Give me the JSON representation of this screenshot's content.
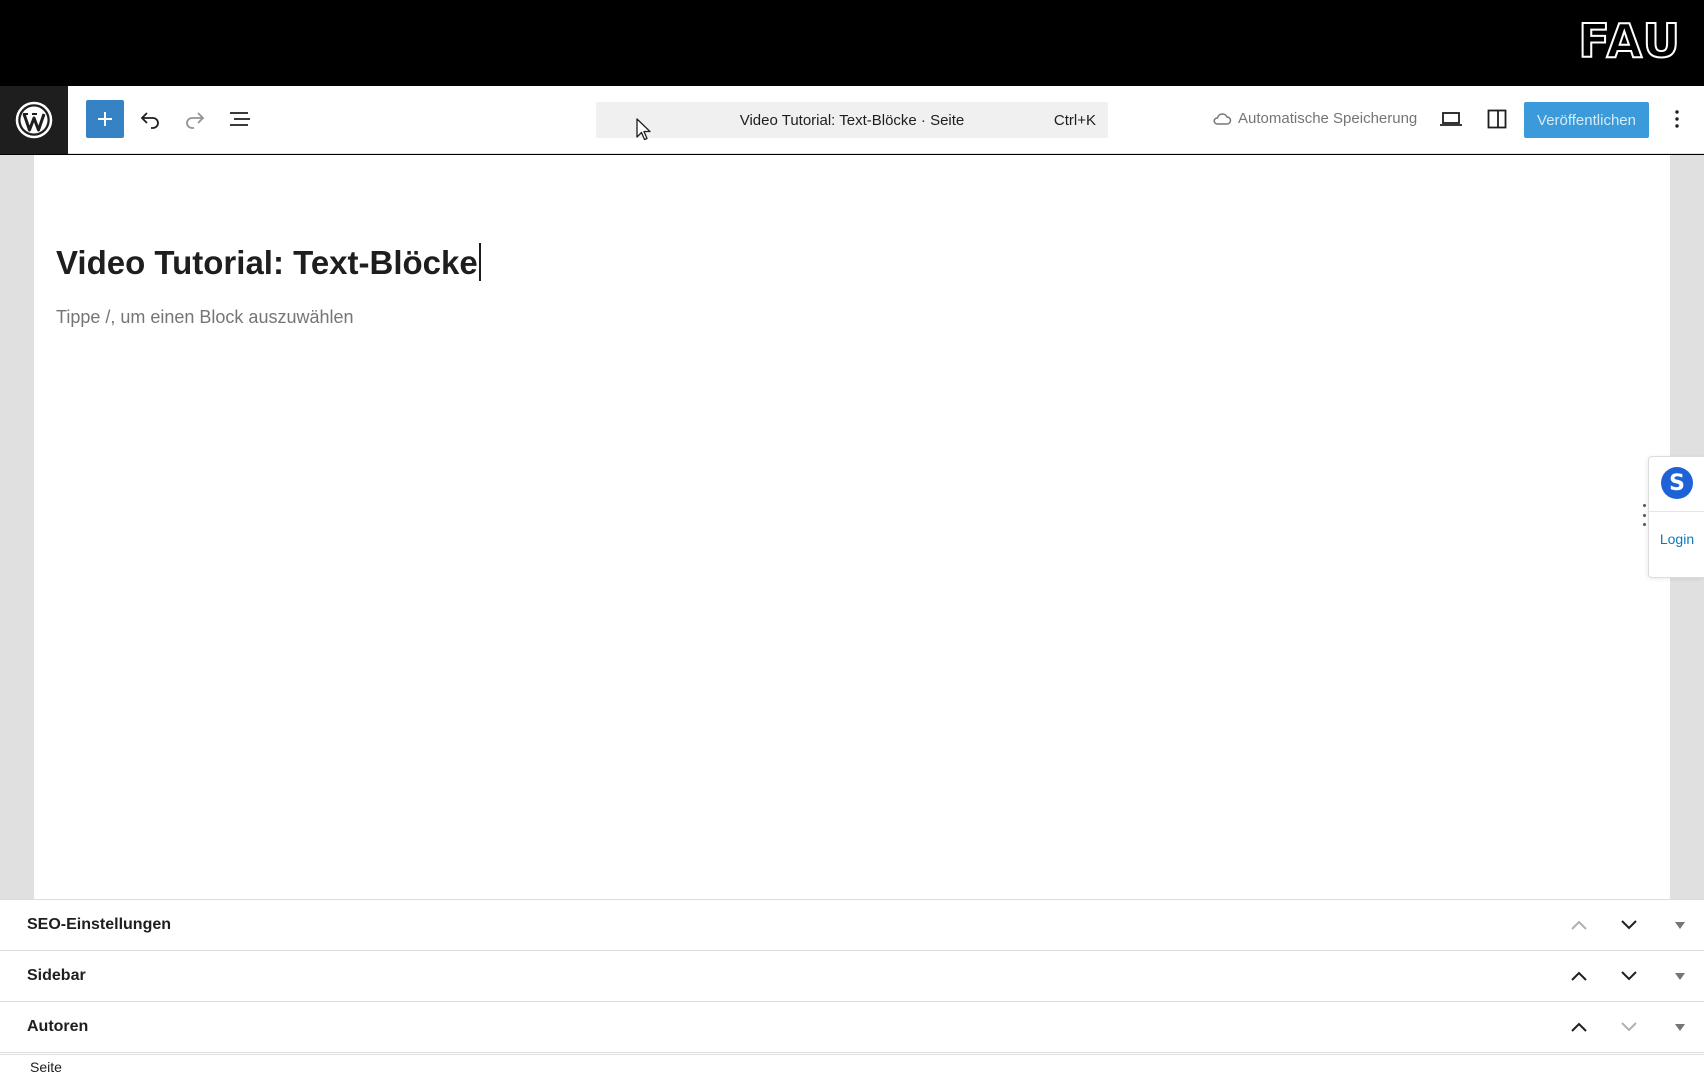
{
  "brand": {
    "logo_text": "FAU"
  },
  "toolbar": {
    "add_block_icon": "plus-icon",
    "undo_icon": "undo-icon",
    "redo_icon": "redo-icon",
    "list_view_icon": "list-view-icon",
    "command": {
      "title": "Video Tutorial: Text-Blöcke · Seite",
      "shortcut": "Ctrl+K"
    },
    "autosave": "Automatische Speicherung",
    "publish_label": "Veröffentlichen",
    "accent_color": "#3582c4"
  },
  "editor": {
    "title": "Video Tutorial: Text-Blöcke",
    "placeholder": "Tippe /, um einen Block auszuwählen"
  },
  "side_widget": {
    "badge": "S",
    "login_label": "Login"
  },
  "metaboxes": [
    {
      "title": "SEO-Einstellungen"
    },
    {
      "title": "Sidebar"
    },
    {
      "title": "Autoren"
    }
  ],
  "footer": {
    "breadcrumb": "Seite"
  }
}
